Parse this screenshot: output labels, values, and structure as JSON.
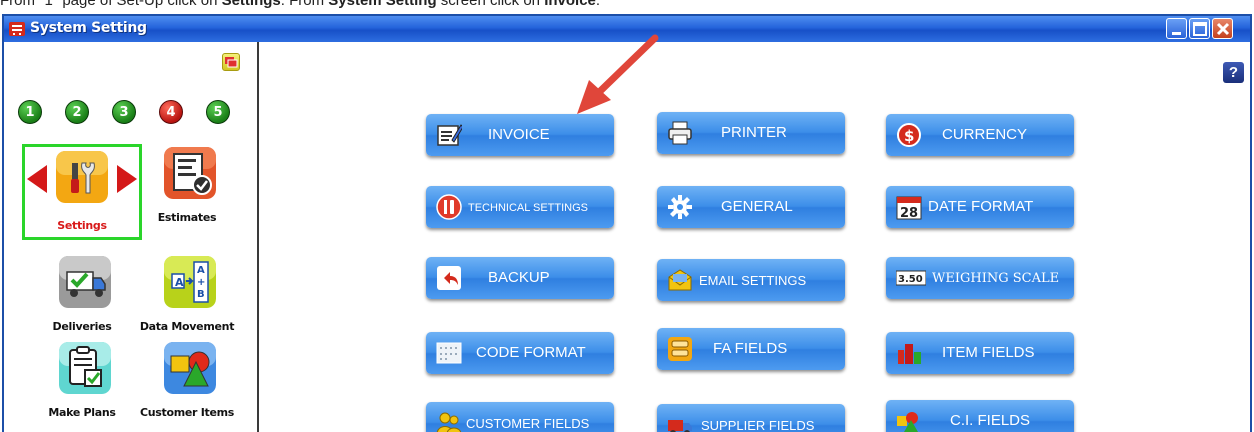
{
  "caption": {
    "prefix": "From \"1\" page of Set-Up click on ",
    "settings": "Settings",
    "middle": ". From ",
    "screen": "System Setting",
    "middle2": " screen click on ",
    "invoice": "Invoice",
    "suffix": "."
  },
  "window": {
    "title": "System Setting",
    "controls": [
      "minimize-icon",
      "maximize-icon",
      "close-icon"
    ]
  },
  "sidebar": {
    "steps": [
      {
        "label": "1",
        "color": "#1f8f1b"
      },
      {
        "label": "2",
        "color": "#1f8f1b"
      },
      {
        "label": "3",
        "color": "#1f8f1b"
      },
      {
        "label": "4",
        "color": "#c81a14"
      },
      {
        "label": "5",
        "color": "#1f8f1b"
      }
    ],
    "items": [
      {
        "label": "Settings",
        "icon": "settings-tools-icon",
        "active": true
      },
      {
        "label": "Estimates",
        "icon": "estimates-document-icon"
      },
      {
        "label": "Deliveries",
        "icon": "delivery-truck-icon"
      },
      {
        "label": "Data Movement",
        "icon": "data-movement-icon"
      },
      {
        "label": "Make Plans",
        "icon": "clipboard-check-icon"
      },
      {
        "label": "Customer Items",
        "icon": "shapes-icon"
      }
    ]
  },
  "main": {
    "help_label": "?",
    "buttons": [
      {
        "label": "INVOICE",
        "icon": "invoice-edit-icon"
      },
      {
        "label": "PRINTER",
        "icon": "printer-icon"
      },
      {
        "label": "CURRENCY",
        "icon": "currency-dollar-icon"
      },
      {
        "label": "TECHNICAL SETTINGS",
        "icon": "technical-tools-icon"
      },
      {
        "label": "GENERAL",
        "icon": "gear-icon"
      },
      {
        "label": "DATE FORMAT",
        "icon": "calendar-icon",
        "icon_text": "28"
      },
      {
        "label": "BACKUP",
        "icon": "backup-arrow-icon"
      },
      {
        "label": "EMAIL SETTINGS",
        "icon": "email-icon"
      },
      {
        "label": "WEIGHING SCALE",
        "icon": "weighing-scale-icon",
        "icon_text": "3.50"
      },
      {
        "label": "CODE FORMAT",
        "icon": "code-format-icon"
      },
      {
        "label": "FA FIELDS",
        "icon": "fa-fields-icon"
      },
      {
        "label": "ITEM FIELDS",
        "icon": "item-fields-icon"
      },
      {
        "label": "CUSTOMER FIELDS",
        "icon": "customer-fields-icon"
      },
      {
        "label": "SUPPLIER FIELDS",
        "icon": "supplier-truck-icon"
      },
      {
        "label": "C.I. FIELDS",
        "icon": "ci-fields-icon"
      }
    ]
  }
}
